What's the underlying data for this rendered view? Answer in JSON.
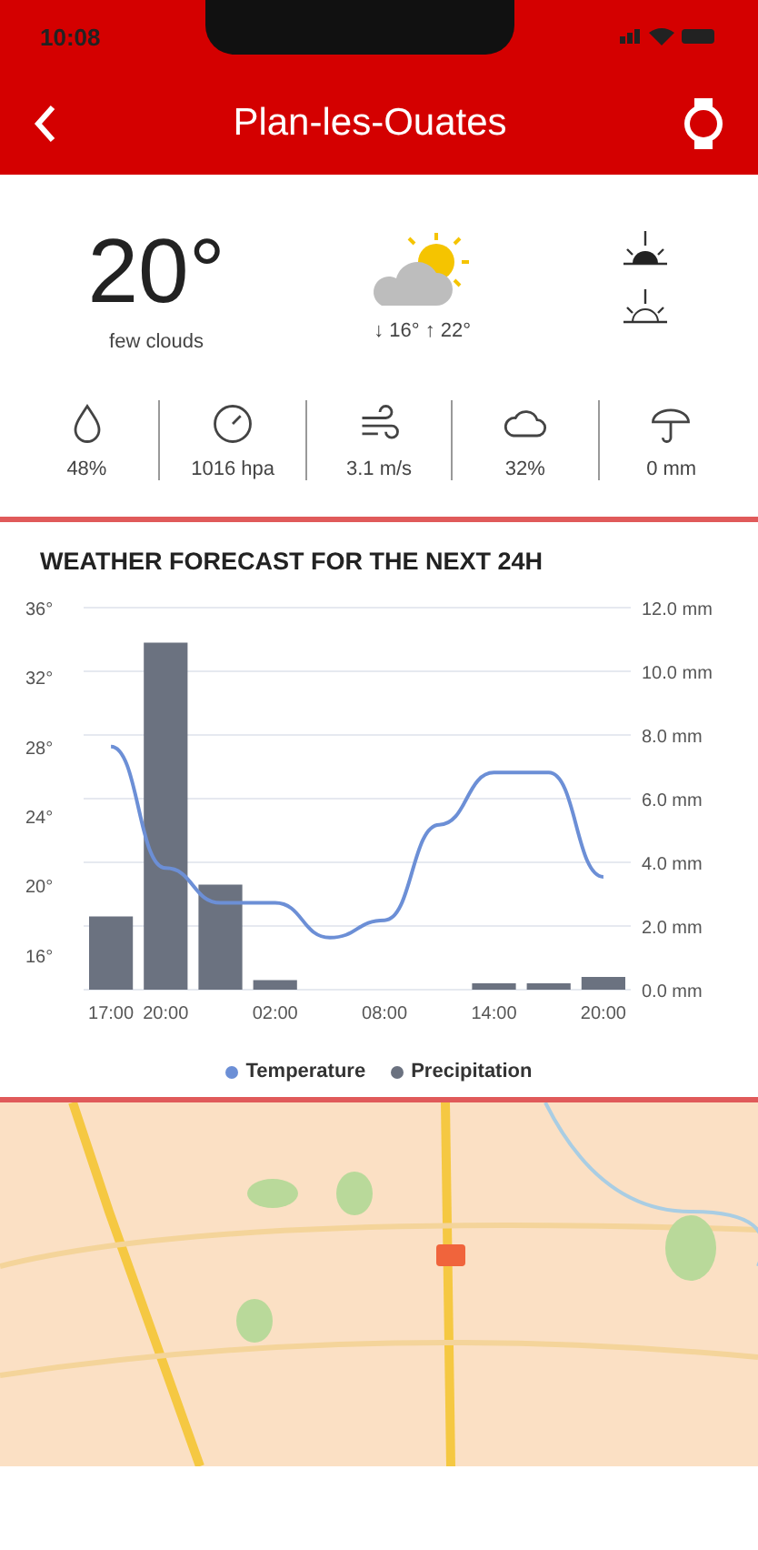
{
  "status_bar": {
    "time": "10:08"
  },
  "header": {
    "title": "Plan-les-Ouates"
  },
  "current": {
    "temperature": "20°",
    "description": "few clouds",
    "low": "↓ 16°",
    "high": "↑ 22°"
  },
  "stats": [
    {
      "kind": "humidity",
      "value": "48%"
    },
    {
      "kind": "pressure",
      "value": "1016 hpa"
    },
    {
      "kind": "wind",
      "value": "3.1 m/s"
    },
    {
      "kind": "clouds",
      "value": "32%"
    },
    {
      "kind": "rain",
      "value": "0 mm"
    }
  ],
  "forecast": {
    "title": "WEATHER FORECAST FOR THE NEXT 24H",
    "chart_data": {
      "type": "bar",
      "categories": [
        "17:00",
        "20:00",
        null,
        "02:00",
        null,
        "08:00",
        null,
        "14:00",
        null,
        "20:00"
      ],
      "ylim": [
        14,
        36
      ],
      "y2lim": [
        0,
        12
      ],
      "grid": true,
      "yticks": [
        {
          "value": 16,
          "label": "16°"
        },
        {
          "value": 20,
          "label": "20°"
        },
        {
          "value": 24,
          "label": "24°"
        },
        {
          "value": 28,
          "label": "28°"
        },
        {
          "value": 32,
          "label": "32°"
        },
        {
          "value": 36,
          "label": "36°"
        }
      ],
      "y2ticks": [
        {
          "value": 0,
          "label": "0.0 mm"
        },
        {
          "value": 2,
          "label": "2.0 mm"
        },
        {
          "value": 4,
          "label": "4.0 mm"
        },
        {
          "value": 6,
          "label": "6.0 mm"
        },
        {
          "value": 8,
          "label": "8.0 mm"
        },
        {
          "value": 10,
          "label": "10.0 mm"
        },
        {
          "value": 12,
          "label": "12.0 mm"
        }
      ],
      "series": [
        {
          "name": "Temperature",
          "color": "#6c8fd6",
          "type": "line",
          "values": [
            28,
            21,
            19,
            19,
            17,
            18,
            23.5,
            26.5,
            26.5,
            20.5
          ]
        },
        {
          "name": "Precipitation",
          "color": "#6b7280",
          "type": "bar",
          "axis": "y2",
          "values": [
            2.3,
            10.9,
            3.3,
            0.3,
            0,
            0,
            0,
            0.2,
            0.2,
            0.4
          ]
        }
      ]
    }
  }
}
